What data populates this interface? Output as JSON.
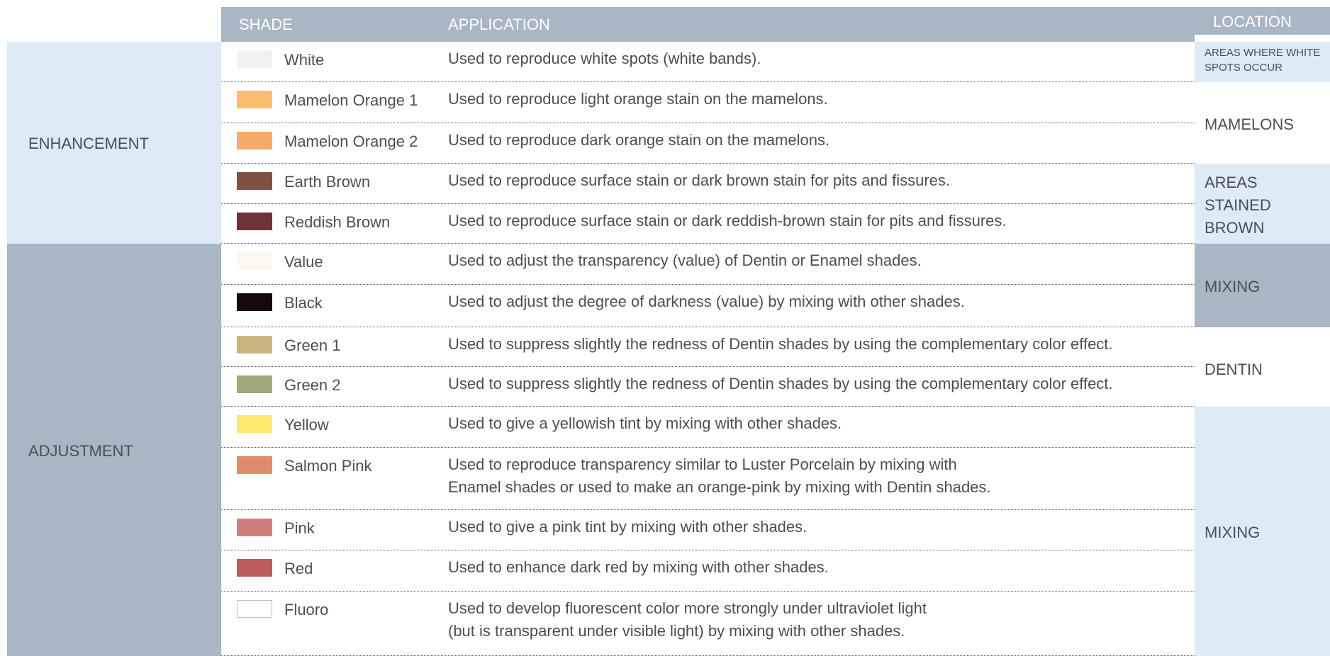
{
  "header": {
    "shade": "SHADE",
    "application": "APPLICATION",
    "location": "LOCATION"
  },
  "groups": {
    "enhancement": "ENHANCEMENT",
    "adjustment": "ADJUSTMENT"
  },
  "rows": [
    {
      "shade": "White",
      "color": "#f2f2f2",
      "app1": "Used to reproduce white spots (white bands).",
      "app2": ""
    },
    {
      "shade": "Mamelon Orange 1",
      "color": "#fbbe6e",
      "app1": "Used to reproduce light orange stain on the mamelons.",
      "app2": ""
    },
    {
      "shade": "Mamelon Orange 2",
      "color": "#f5ab6c",
      "app1": "Used to reproduce dark orange stain on the mamelons.",
      "app2": ""
    },
    {
      "shade": "Earth Brown",
      "color": "#7f5043",
      "app1": "Used to reproduce surface stain or dark brown stain for pits and fissures.",
      "app2": ""
    },
    {
      "shade": "Reddish Brown",
      "color": "#6c333a",
      "app1": "Used to reproduce surface stain or dark reddish-brown stain for pits and fissures.",
      "app2": ""
    },
    {
      "shade": "Value",
      "color": "#fbf8f2",
      "app1": "Used to adjust the transparency (value) of Dentin or Enamel shades.",
      "app2": ""
    },
    {
      "shade": "Black",
      "color": "#140c0c",
      "app1": "Used to adjust the degree of darkness (value) by mixing with other shades.",
      "app2": ""
    },
    {
      "shade": "Green 1",
      "color": "#c8b47c",
      "app1": "Used to suppress slightly the redness of Dentin shades by using the complementary color effect.",
      "app2": ""
    },
    {
      "shade": "Green 2",
      "color": "#a2a97d",
      "app1": "Used to suppress slightly the redness of Dentin shades by using the complementary color effect.",
      "app2": ""
    },
    {
      "shade": "Yellow",
      "color": "#fbea6c",
      "app1": "Used to give a yellowish tint by mixing with other shades.",
      "app2": ""
    },
    {
      "shade": "Salmon Pink",
      "color": "#e08a6e",
      "app1": "Used to reproduce transparency similar to Luster Porcelain by mixing with",
      "app2": "Enamel shades or used to make an orange-pink by mixing with Dentin shades."
    },
    {
      "shade": "Pink",
      "color": "#d27d7d",
      "app1": "Used to give a pink tint by mixing with other shades.",
      "app2": ""
    },
    {
      "shade": "Red",
      "color": "#bb5d5d",
      "app1": "Used to enhance dark red by mixing with other shades.",
      "app2": ""
    },
    {
      "shade": "Fluoro",
      "color": "#ffffff",
      "app1": "Used to develop fluorescent color more strongly under ultraviolet light",
      "app2": "(but is transparent under visible light) by mixing with other shades."
    }
  ],
  "locations": {
    "white_spots": {
      "l1": "AREAS WHERE WHITE",
      "l2": "SPOTS OCCUR"
    },
    "mamelons": "MAMELONS",
    "stained_brown": {
      "l1": "AREAS",
      "l2": "STAINED",
      "l3": "BROWN"
    },
    "mixing_1": "MIXING",
    "dentin": "DENTIN",
    "mixing_2": "MIXING"
  },
  "colors": {
    "header_bg": "#a9b6c3",
    "enhancement_bg": "#deeaf6",
    "adjustment_bg": "#a9b6c3",
    "location_light_bg": "#deeaf6",
    "location_dark_bg": "#a9b6c3"
  }
}
